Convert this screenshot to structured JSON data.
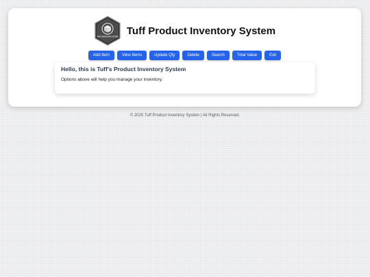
{
  "header": {
    "title": "Tuff Product Inventory System",
    "logo_icon": "box-logo-icon",
    "logo_text": "TUFF INVENTORY SYSTEM"
  },
  "toolbar": {
    "buttons": [
      {
        "label": "Add Item"
      },
      {
        "label": "View Items"
      },
      {
        "label": "Update Qty"
      },
      {
        "label": "Delete"
      },
      {
        "label": "Search"
      },
      {
        "label": "Total Value"
      },
      {
        "label": "Exit"
      }
    ],
    "accent_color": "#2563eb"
  },
  "welcome": {
    "title": "Hello, this is Tuff's Product Inventory System",
    "text": "Options above will help you manage your inventory."
  },
  "footer": {
    "text": "© 2025 Tuff Product Inventory System | All Rights Reserved."
  }
}
